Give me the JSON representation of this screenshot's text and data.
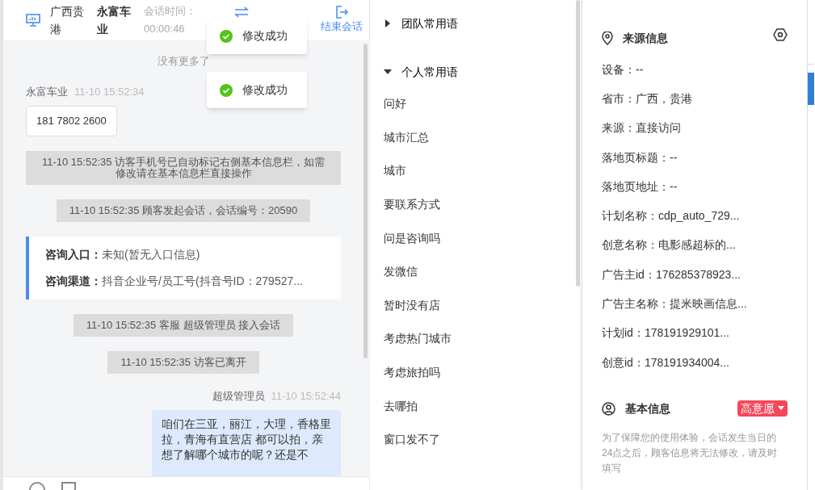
{
  "header": {
    "region": "广西贵港",
    "customer": "永富车业",
    "duration_label": "会话时间：",
    "duration": "00:00:46",
    "end_label": "结束会话"
  },
  "toasts": [
    {
      "kind": "success",
      "text": "修改成功"
    },
    {
      "kind": "success",
      "text": "修改成功"
    }
  ],
  "messages": [
    {
      "kind": "notice",
      "text": "没有更多了"
    },
    {
      "kind": "visitor",
      "name": "永富车业",
      "time": "11-10 15:52:34",
      "text": "181 7802 2600"
    },
    {
      "kind": "system",
      "text": "11-10 15:52:35 访客手机号已自动标记右侧基本信息栏，如需修改请在基本信息栏直接操作"
    },
    {
      "kind": "system",
      "text": "11-10 15:52:35 顾客发起会话，会话编号：20590"
    },
    {
      "kind": "info_card",
      "fields": [
        {
          "label": "咨询入口：",
          "value": "未知(暂无入口信息)"
        },
        {
          "label": "咨询渠道：",
          "value": "抖音企业号/员工号(抖音号ID：279527..."
        }
      ]
    },
    {
      "kind": "system",
      "text": "11-10 15:52:35 客服 超级管理员 接入会话"
    },
    {
      "kind": "system",
      "text": "11-10 15:52:35 访客已离开"
    },
    {
      "kind": "agent",
      "name": "超级管理员",
      "time": "11-10 15:52:44",
      "text": "咱们在三亚，丽江，大理，香格里拉，青海有直营店 都可以拍，亲想了解哪个城市的呢？还是不"
    }
  ],
  "phrase_groups": [
    {
      "title": "团队常用语",
      "expanded": false
    },
    {
      "title": "个人常用语",
      "expanded": true,
      "items": [
        "问好",
        "城市汇总",
        "城市",
        "要联系方式",
        "问是咨询吗",
        "发微信",
        "暂时没有店",
        "考虑热门城市",
        "考虑旅拍吗",
        "去哪拍",
        "窗口发不了"
      ]
    }
  ],
  "source_info": {
    "title": "来源信息",
    "rows": [
      "设备：--",
      "省市：广西，贵港",
      "来源：直接访问",
      "落地页标题：--",
      "落地页地址：--",
      "计划名称：cdp_auto_729...",
      "创意名称：电影感超标的...",
      "广告主id：176285378923...",
      "广告主名称：提米映画信息...",
      "计划id：178191929101...",
      "创意id：178191934004..."
    ]
  },
  "basic_info": {
    "title": "基本信息",
    "intent": {
      "label": "高意愿",
      "color": "#f5475a"
    },
    "notice": "为了保障您的使用体验，会话发生当日的24点之后，顾客信息将无法修改，请及时填写"
  }
}
